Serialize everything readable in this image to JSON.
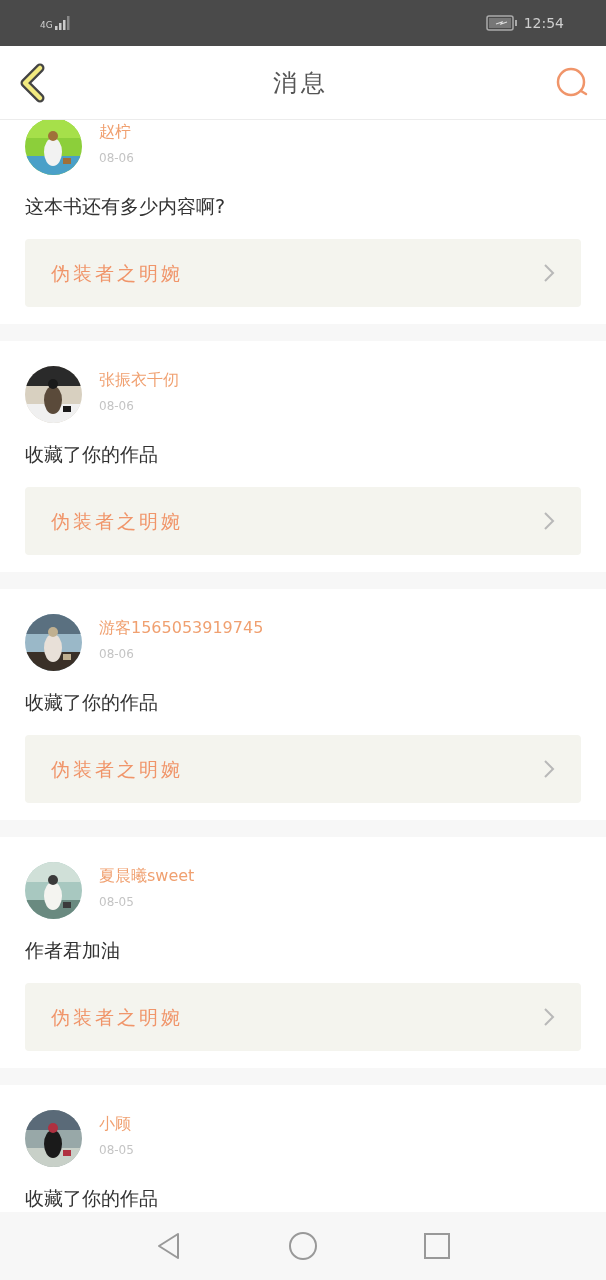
{
  "status_bar": {
    "network": "4G",
    "time": "12:54"
  },
  "header": {
    "title": "消息"
  },
  "messages": [
    {
      "user": "赵柠",
      "date": "08-06",
      "text": "这本书还有多少内容啊?",
      "book": "伪装者之明婉"
    },
    {
      "user": "张振衣千仞",
      "date": "08-06",
      "text": "收藏了你的作品",
      "book": "伪装者之明婉"
    },
    {
      "user": "游客1565053919745",
      "date": "08-06",
      "text": "收藏了你的作品",
      "book": "伪装者之明婉"
    },
    {
      "user": "夏晨曦sweet",
      "date": "08-05",
      "text": "作者君加油",
      "book": "伪装者之明婉"
    },
    {
      "user": "小顾",
      "date": "08-05",
      "text": "收藏了你的作品"
    }
  ]
}
